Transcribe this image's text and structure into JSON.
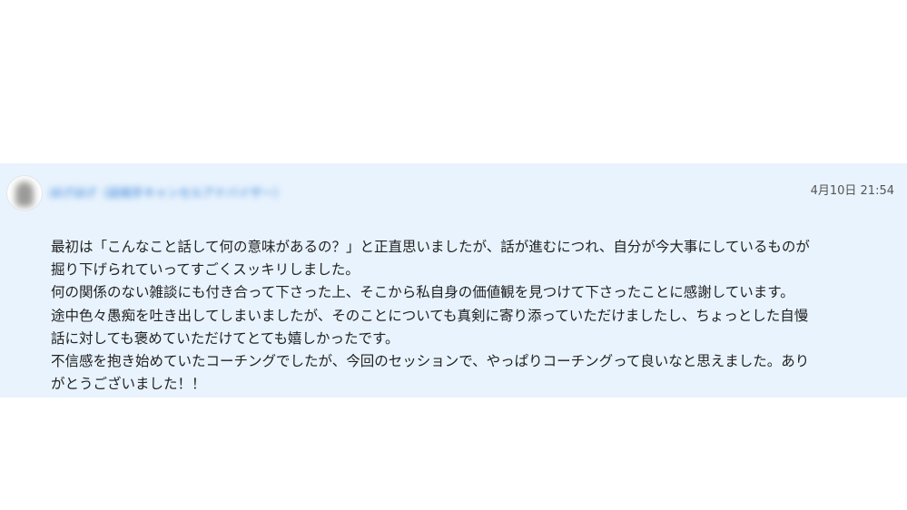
{
  "review": {
    "user": {
      "name": "ほげほげ（話相手キャンセルアドバイザー）"
    },
    "timestamp": "4月10日 21:54",
    "lines": [
      "最初は「こんなこと話して何の意味があるの？」と正直思いましたが、話が進むにつれ、自分が今大事にしているものが",
      "掘り下げられていってすごくスッキリしました。",
      "何の関係のない雑談にも付き合って下さった上、そこから私自身の価値観を見つけて下さったことに感謝しています。",
      "途中色々愚痴を吐き出してしまいましたが、そのことについても真剣に寄り添っていただけましたし、ちょっとした自慢",
      "話に対しても褒めていただけてとても嬉しかったです。",
      "不信感を抱き始めていたコーチングでしたが、今回のセッションで、やっぱりコーチングって良いなと思えました。あり",
      "がとうございました！！"
    ]
  }
}
